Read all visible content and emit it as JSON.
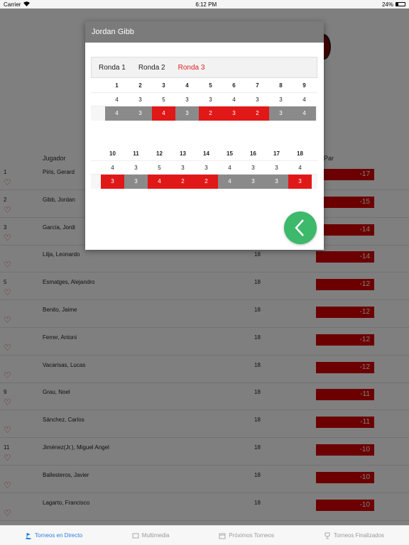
{
  "status_bar": {
    "carrier": "Carrier",
    "time": "6:12 PM",
    "battery": "24%"
  },
  "leaderboard": {
    "col_player": "Jugador",
    "col_par": "Par",
    "rows": [
      {
        "pos": "1",
        "name": "Piris, Gerard",
        "holes": "",
        "score": "-17"
      },
      {
        "pos": "2",
        "name": "Gibb, Jordan",
        "holes": "",
        "score": "-15"
      },
      {
        "pos": "3",
        "name": "García, Jordi",
        "holes": "",
        "score": "-14"
      },
      {
        "pos": "",
        "name": "Lilja, Leonardo",
        "holes": "18",
        "score": "-14"
      },
      {
        "pos": "5",
        "name": "Esmatges, Alejandro",
        "holes": "18",
        "score": "-12"
      },
      {
        "pos": "",
        "name": "Benito, Jaime",
        "holes": "18",
        "score": "-12"
      },
      {
        "pos": "",
        "name": "Ferrer, Antoni",
        "holes": "18",
        "score": "-12"
      },
      {
        "pos": "",
        "name": "Vacarisas, Lucas",
        "holes": "18",
        "score": "-12"
      },
      {
        "pos": "9",
        "name": "Grau, Noel",
        "holes": "18",
        "score": "-11"
      },
      {
        "pos": "",
        "name": "Sánchez, Carlos",
        "holes": "18",
        "score": "-11"
      },
      {
        "pos": "11",
        "name": "Jiménez(Jr.), Miguel Angel",
        "holes": "18",
        "score": "-10"
      },
      {
        "pos": "",
        "name": "Ballesteros, Javier",
        "holes": "18",
        "score": "-10"
      },
      {
        "pos": "",
        "name": "Lagarto, Francisco",
        "holes": "18",
        "score": "-10"
      }
    ]
  },
  "modal": {
    "title": "Jordan Gibb",
    "tabs": [
      {
        "label": "Ronda 1",
        "active": false
      },
      {
        "label": "Ronda 2",
        "active": false
      },
      {
        "label": "Ronda 3",
        "active": true
      }
    ],
    "front": {
      "holes": [
        "1",
        "2",
        "3",
        "4",
        "5",
        "6",
        "7",
        "8",
        "9"
      ],
      "par": [
        "4",
        "3",
        "5",
        "3",
        "3",
        "4",
        "3",
        "3",
        "4"
      ],
      "scores": [
        "4",
        "3",
        "4",
        "3",
        "2",
        "3",
        "2",
        "3",
        "4"
      ],
      "colors": [
        "gray",
        "gray",
        "red",
        "gray",
        "red",
        "red",
        "red",
        "gray",
        "gray"
      ]
    },
    "back": {
      "holes": [
        "10",
        "11",
        "12",
        "13",
        "14",
        "15",
        "16",
        "17",
        "18"
      ],
      "par": [
        "4",
        "3",
        "5",
        "3",
        "3",
        "4",
        "3",
        "3",
        "4"
      ],
      "scores": [
        "3",
        "3",
        "4",
        "2",
        "2",
        "4",
        "3",
        "3",
        "3"
      ],
      "colors": [
        "red",
        "gray",
        "red",
        "red",
        "red",
        "gray",
        "gray",
        "gray",
        "red"
      ]
    }
  },
  "tabbar": {
    "items": [
      {
        "label": "Torneos en Directo",
        "active": true
      },
      {
        "label": "Multimedia",
        "active": false
      },
      {
        "label": "Próximos Torneos",
        "active": false
      },
      {
        "label": "Torneos Finalizados",
        "active": false
      }
    ]
  },
  "colors": {
    "red": "#e01818",
    "gray": "#8a8a8a",
    "green_fab": "#3cb96a",
    "active_tab": "#2b7de0"
  }
}
